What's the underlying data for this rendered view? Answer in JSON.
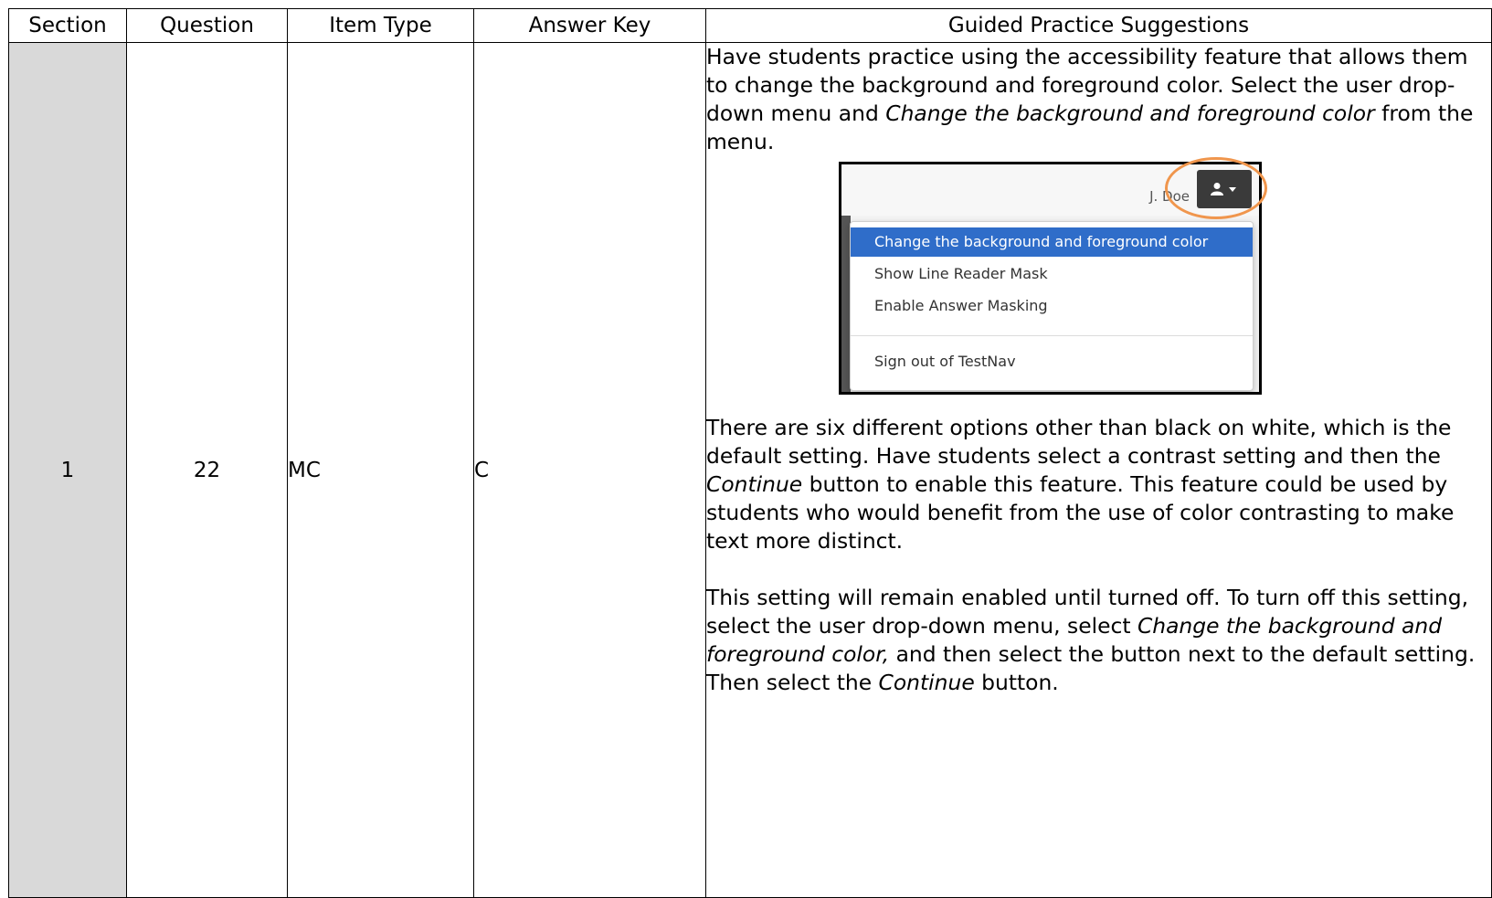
{
  "table": {
    "headers": [
      "Section",
      "Question",
      "Item Type",
      "Answer Key",
      "Guided Practice Suggestions"
    ],
    "row": {
      "section": "1",
      "question": "22",
      "item_type": "MC",
      "answer_key": "C"
    }
  },
  "guided": {
    "p1": {
      "lead": " Have students practice using the accessibility feature that allows them to change the background and foreground color.  Select the user drop-down menu and ",
      "em": "Change the background and foreground color",
      "tail": " from the menu."
    },
    "screenshot": {
      "user_name": "J. Doe",
      "user_button_icon": "user-caret-icon",
      "menu_items": [
        "Change the background and foreground color",
        "Show Line Reader Mask",
        "Enable Answer Masking",
        "Sign out of TestNav"
      ],
      "highlight_color": "#f0964d",
      "active_color": "#2f6dc9"
    },
    "p2": {
      "lead": "There are six different options other than black on white, which is the default setting.  Have students select a contrast setting and then the ",
      "em": "Continue",
      "tail": " button to enable this feature.  This feature could be used by students who would benefit from the use of color contrasting to make text more distinct."
    },
    "p3": {
      "lead": "This setting will remain enabled until turned off.  To turn off this setting, select the user drop-down menu, select ",
      "em1": "Change the background and foreground color,",
      "mid": " and then select the button next to the default setting.  Then select the ",
      "em2": "Continue",
      "tail": " button."
    }
  }
}
